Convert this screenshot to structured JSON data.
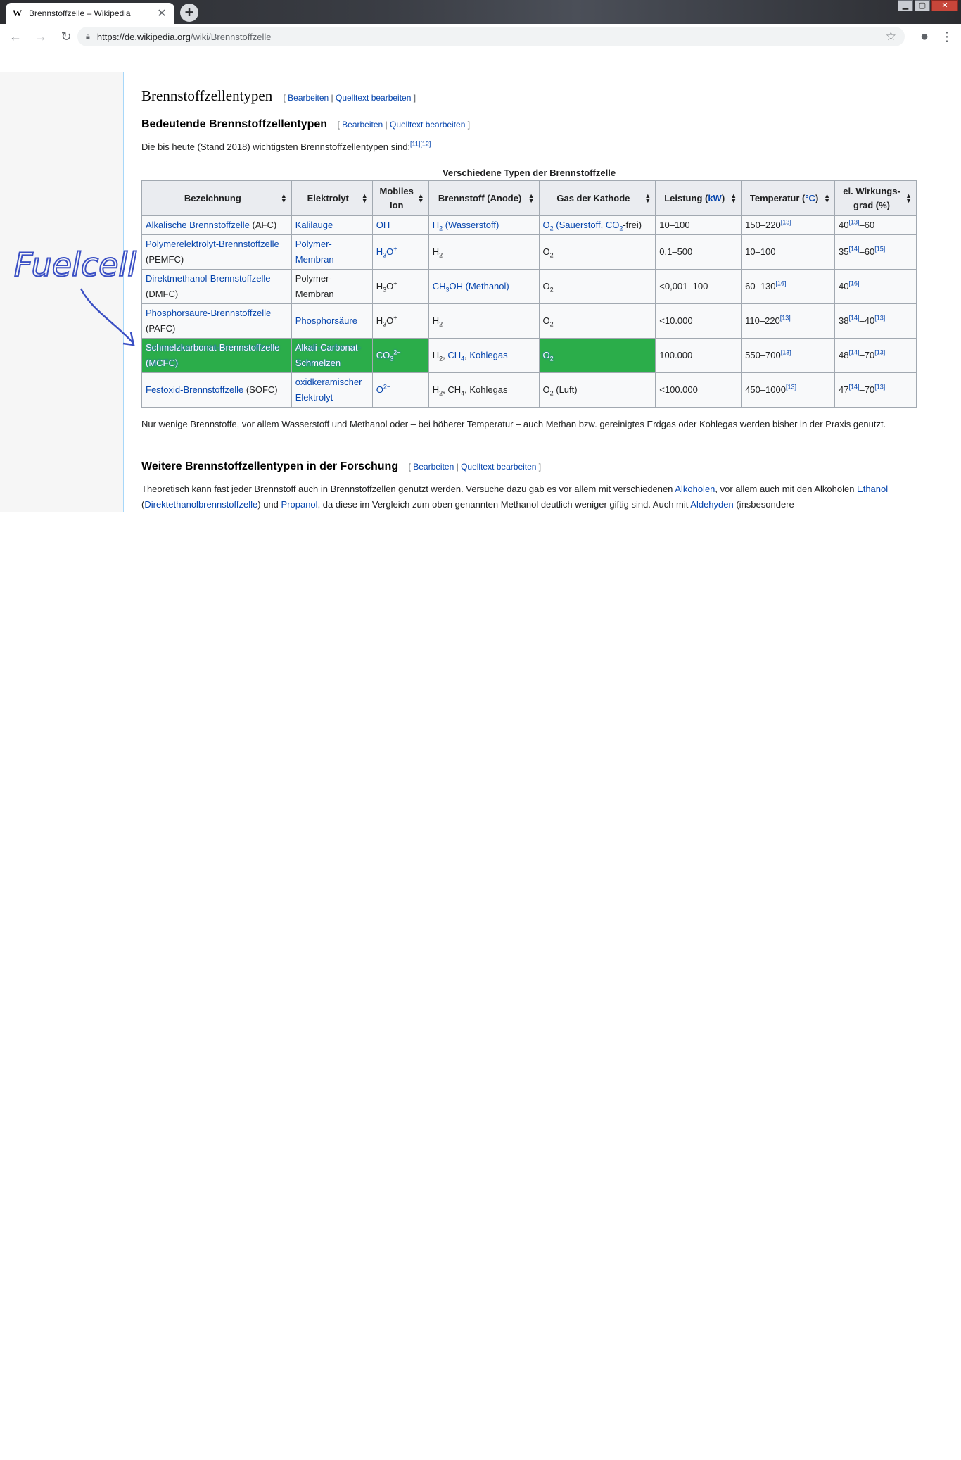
{
  "browser": {
    "tab_title": "Brennstoffzelle – Wikipedia",
    "tab_favicon": "W",
    "url_host": "https://de.wikipedia.org",
    "url_path": "/wiki/Brennstoffzelle",
    "icons": [
      "back-arrow-icon",
      "forward-arrow-icon",
      "reload-icon",
      "lock-icon",
      "star-icon",
      "profile-icon",
      "menu-icon",
      "new-tab-icon",
      "close-tab-icon"
    ]
  },
  "article": {
    "section_title": "Brennstoffzellentypen",
    "edit": "Bearbeiten",
    "edit_source": "Quelltext bearbeiten",
    "sub1_title": "Bedeutende Brennstoffzellentypen",
    "intro_text": "Die bis heute (Stand 2018) wichtigsten Brennstoffzellentypen sind:",
    "intro_refs": "[11][12]",
    "table": {
      "caption": "Verschiedene Typen der Brennstoffzelle",
      "headers": {
        "h1": "Bezeichnung",
        "h2": "Elektrolyt",
        "h3": "Mobiles Ion",
        "h4": "Brennstoff (Anode)",
        "h5": "Gas der Kathode",
        "h6a": "Leistung (",
        "h6b": "kW",
        "h6c": ")",
        "h7a": "Temperatur (",
        "h7b": "°C",
        "h7c": ")",
        "h8": "el. Wirkungs-grad (%)"
      },
      "rows": {
        "afc": {
          "name": "Alkalische Brennstoffzelle",
          "abbr": " (AFC)",
          "elektrolyt": "Kalilauge",
          "ion": "OH",
          "ion_sup": "−",
          "fuel": "H",
          "fuel_sub": "2",
          "fuel_rest": " (Wasserstoff)",
          "gas": "O",
          "gas_sub": "2",
          "gas_rest": " (Sauerstoff, CO",
          "gas_sub2": "2",
          "gas_rest2": "-frei)",
          "leistung": "10–100",
          "temp": "150–220",
          "temp_ref": "[13]",
          "eff_a": "40",
          "eff_ref": "[13]",
          "eff_b": "–60"
        },
        "pemfc": {
          "name": "Polymerelektrolyt-Brennstoffzelle",
          "abbr": " (PEMFC)",
          "elektrolyt": "Polymer-Membran",
          "ion": "H",
          "ion_sub": "3",
          "ion_b": "O",
          "ion_sup": "+",
          "fuel": "H",
          "fuel_sub": "2",
          "gas": "O",
          "gas_sub": "2",
          "leistung": "0,1–500",
          "temp": "10–100",
          "eff_a": "35",
          "eff_ref": "[14]",
          "eff_b": "–60",
          "eff_ref2": "[15]"
        },
        "dmfc": {
          "name": "Direktmethanol-Brennstoffzelle",
          "abbr": " (DMFC)",
          "elektrolyt": "Polymer-Membran",
          "ion": "H",
          "ion_sub": "3",
          "ion_b": "O",
          "ion_sup": "+",
          "fuel": "CH",
          "fuel_sub": "3",
          "fuel_rest": "OH (Methanol)",
          "gas": "O",
          "gas_sub": "2",
          "leistung": "<0,001–100",
          "temp": "60–130",
          "temp_ref": "[16]",
          "eff_a": "40",
          "eff_ref": "[16]"
        },
        "pafc": {
          "name": "Phosphorsäure-Brennstoffzelle",
          "abbr": " (PAFC)",
          "elektrolyt": "Phosphorsäure",
          "ion": "H",
          "ion_sub": "3",
          "ion_b": "O",
          "ion_sup": "+",
          "fuel": "H",
          "fuel_sub": "2",
          "gas": "O",
          "gas_sub": "2",
          "leistung": "<10.000",
          "temp": "110–220",
          "temp_ref": "[13]",
          "eff_a": "38",
          "eff_ref": "[14]",
          "eff_b": "–40",
          "eff_ref2": "[13]"
        },
        "mcfc": {
          "name": "Schmelzkarbonat-Brennstoffzelle",
          "abbr": " (MCFC)",
          "elektrolyt": "Alkali-Carbonat-Schmelzen",
          "ion": "CO",
          "ion_sub": "3",
          "ion_sup": "2−",
          "fuel_a": "H",
          "fuel_sub": "2",
          "fuel_b": ", ",
          "fuel_c": "CH",
          "fuel_sub2": "4",
          "fuel_d": ", ",
          "fuel_e": "Kohlegas",
          "gas": "O",
          "gas_sub": "2",
          "leistung": "100.000",
          "temp": "550–700",
          "temp_ref": "[13]",
          "eff_a": "48",
          "eff_ref": "[14]",
          "eff_b": "–70",
          "eff_ref2": "[13]"
        },
        "sofc": {
          "name": "Festoxid-Brennstoffzelle",
          "abbr": " (SOFC)",
          "elektrolyt": "oxidkeramischer Elektrolyt",
          "ion": "O",
          "ion_sup": "2−",
          "fuel_a": "H",
          "fuel_sub": "2",
          "fuel_b": ", CH",
          "fuel_sub2": "4",
          "fuel_c": ", Kohlegas",
          "gas": "O",
          "gas_sub": "2",
          "gas_rest": " (Luft)",
          "leistung": "<100.000",
          "temp": "450–1000",
          "temp_ref": "[13]",
          "eff_a": "47",
          "eff_ref": "[14]",
          "eff_b": "–70",
          "eff_ref2": "[13]"
        }
      },
      "highlight_color": "#2bad4a"
    },
    "after_table": "Nur wenige Brennstoffe, vor allem Wasserstoff und Methanol oder – bei höherer Temperatur – auch Methan bzw. gereinigtes Erdgas oder Kohlegas werden bisher in der Praxis genutzt.",
    "sub2_title": "Weitere Brennstoffzellentypen in der Forschung",
    "research": {
      "t1": "Theoretisch kann fast jeder Brennstoff auch in Brennstoffzellen genutzt werden. Versuche dazu gab es vor allem mit verschiedenen ",
      "l1": "Alkoholen",
      "t2": ", vor allem auch mit den Alkoholen ",
      "l2": "Ethanol",
      "t3": " (",
      "l3": "Direktethanolbrennstoffzelle",
      "t4": ") und ",
      "l4": "Propanol",
      "t5": ", da diese im Vergleich zum oben genannten Methanol deutlich weniger giftig sind. Auch mit ",
      "l5": "Aldehyden",
      "t6": " (insbesondere"
    }
  },
  "annotation": {
    "text": "Fuelcell",
    "color": "#3a4fc4"
  }
}
